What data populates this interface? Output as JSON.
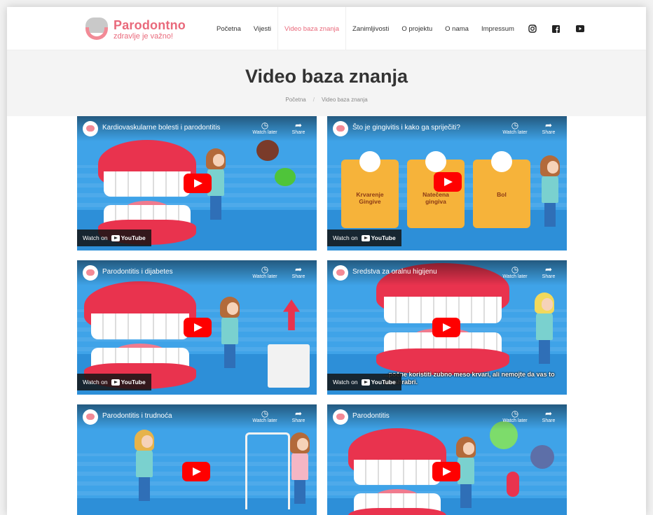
{
  "brand": {
    "title": "Parodontno",
    "subtitle": "zdravlje je važno!",
    "accent": "#e9697b"
  },
  "nav": {
    "items": [
      "Početna",
      "Vijesti",
      "Video baza znanja",
      "Zanimljivosti",
      "O projektu",
      "O nama",
      "Impressum"
    ],
    "active": "Video baza znanja",
    "social": [
      "instagram-icon",
      "facebook-icon",
      "youtube-icon"
    ]
  },
  "hero": {
    "title": "Video baza znanja",
    "breadcrumb": [
      "Početna",
      "Video baza znanja"
    ]
  },
  "video_controls": {
    "watch_later": "Watch later",
    "share": "Share",
    "watch_on": "Watch on",
    "youtube": "YouTube"
  },
  "videos": [
    {
      "title": "Kardiovaskularne bolesti i parodontitis"
    },
    {
      "title": "Što je gingivitis i kako ga spriječiti?",
      "cards": [
        "Krvarenje\nGingive",
        "Natečena\ngingiva",
        "Bol"
      ]
    },
    {
      "title": "Parodontitis i dijabetes"
    },
    {
      "title": "Sredstva za oralnu higijenu",
      "caption": "...počne koristiti zubno meso krvari, ali nemojte da vas to obeshrabri."
    },
    {
      "title": "Parodontitis i trudnoća"
    },
    {
      "title": "Parodontitis"
    }
  ]
}
